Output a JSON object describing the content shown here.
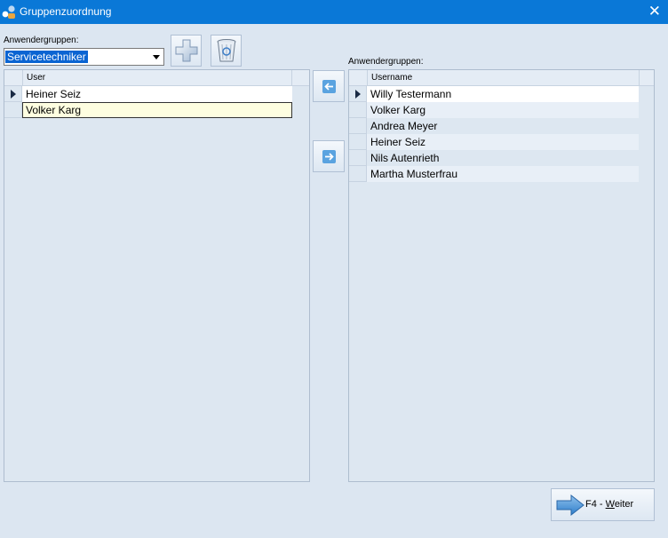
{
  "window": {
    "title": "Gruppenzuordnung"
  },
  "left_panel": {
    "label": "Anwendergruppen:",
    "combo_value": "Servicetechniker",
    "column_header": "User",
    "rows": [
      "Heiner Seiz",
      "Volker Karg"
    ]
  },
  "right_panel": {
    "label": "Anwendergruppen:",
    "column_header": "Username",
    "rows": [
      "Willy Testermann",
      "Volker Karg",
      "Andrea Meyer",
      "Heiner Seiz",
      "Nils Autenrieth",
      "Martha Musterfrau"
    ]
  },
  "footer": {
    "next_prefix": "F4 - ",
    "next_mnemonic": "W",
    "next_rest": "eiter"
  },
  "icons": {
    "add": "plus-icon",
    "delete": "recycle-bin-icon",
    "move_left": "arrow-left-icon",
    "move_right": "arrow-right-icon",
    "next": "big-arrow-right-icon",
    "close": "close-icon"
  },
  "colors": {
    "titlebar": "#0a78d7",
    "background": "#dce6f1",
    "selection": "#0a64d2",
    "row_highlight": "#fefee0",
    "row_alt": "#e8eff7"
  }
}
